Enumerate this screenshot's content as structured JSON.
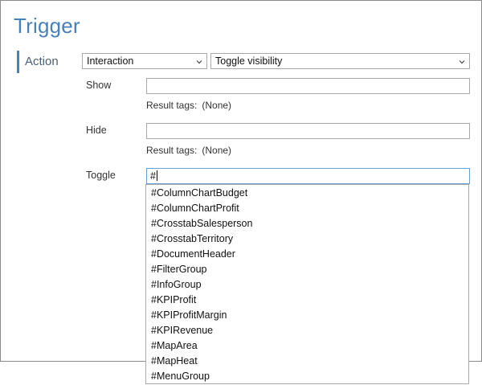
{
  "dialog": {
    "title": "Trigger",
    "section_label": "Action",
    "action_type": {
      "selected": "Interaction"
    },
    "interaction_type": {
      "selected": "Toggle visibility"
    },
    "show": {
      "label": "Show",
      "value": "",
      "result_label": "Result tags:",
      "result_value": "(None)"
    },
    "hide": {
      "label": "Hide",
      "value": "",
      "result_label": "Result tags:",
      "result_value": "(None)"
    },
    "toggle": {
      "label": "Toggle",
      "value": "#"
    },
    "autocomplete": [
      "#ColumnChartBudget",
      "#ColumnChartProfit",
      "#CrosstabSalesperson",
      "#CrosstabTerritory",
      "#DocumentHeader",
      "#FilterGroup",
      "#InfoGroup",
      "#KPIProfit",
      "#KPIProfitMargin",
      "#KPIRevenue",
      "#MapArea",
      "#MapHeat",
      "#MenuGroup"
    ]
  },
  "colors": {
    "accent": "#4a80b8",
    "focus_border": "#6a9fd4",
    "border": "#a9a9a9"
  }
}
